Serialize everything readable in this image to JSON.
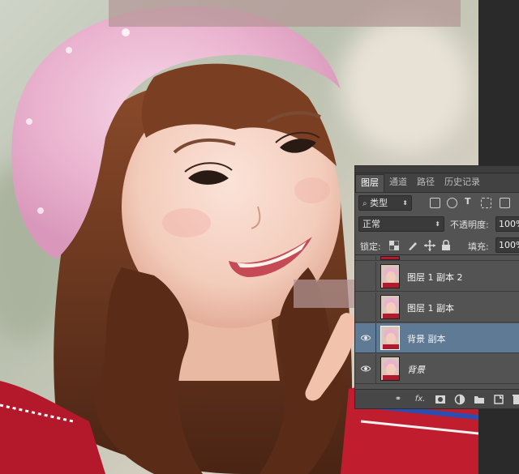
{
  "panel": {
    "tabs": [
      {
        "label": "图层",
        "active": true
      },
      {
        "label": "通道",
        "active": false
      },
      {
        "label": "路径",
        "active": false
      },
      {
        "label": "历史记录",
        "active": false
      }
    ],
    "filter": {
      "label": "类型"
    },
    "blend_mode": "正常",
    "opacity_label": "不透明度:",
    "opacity_value": "100%",
    "lock_label": "锁定:",
    "fill_label": "填充:",
    "fill_value": "100%",
    "layers": [
      {
        "name": "图层 1 副本 2",
        "visible": false,
        "selected": false,
        "italic": false
      },
      {
        "name": "图层 1 副本",
        "visible": false,
        "selected": false,
        "italic": false
      },
      {
        "name": "背景 副本",
        "visible": true,
        "selected": true,
        "italic": false
      },
      {
        "name": "背景",
        "visible": true,
        "selected": false,
        "italic": true
      }
    ],
    "bottom_icons": [
      "link-icon",
      "fx-icon",
      "mask-icon",
      "adjustment-icon",
      "folder-icon",
      "new-layer-icon",
      "trash-icon"
    ],
    "fx_label": "fx."
  },
  "colors": {
    "panel_bg": "#535353",
    "selected_layer": "#5f7a95",
    "watermark": "#b49696"
  }
}
